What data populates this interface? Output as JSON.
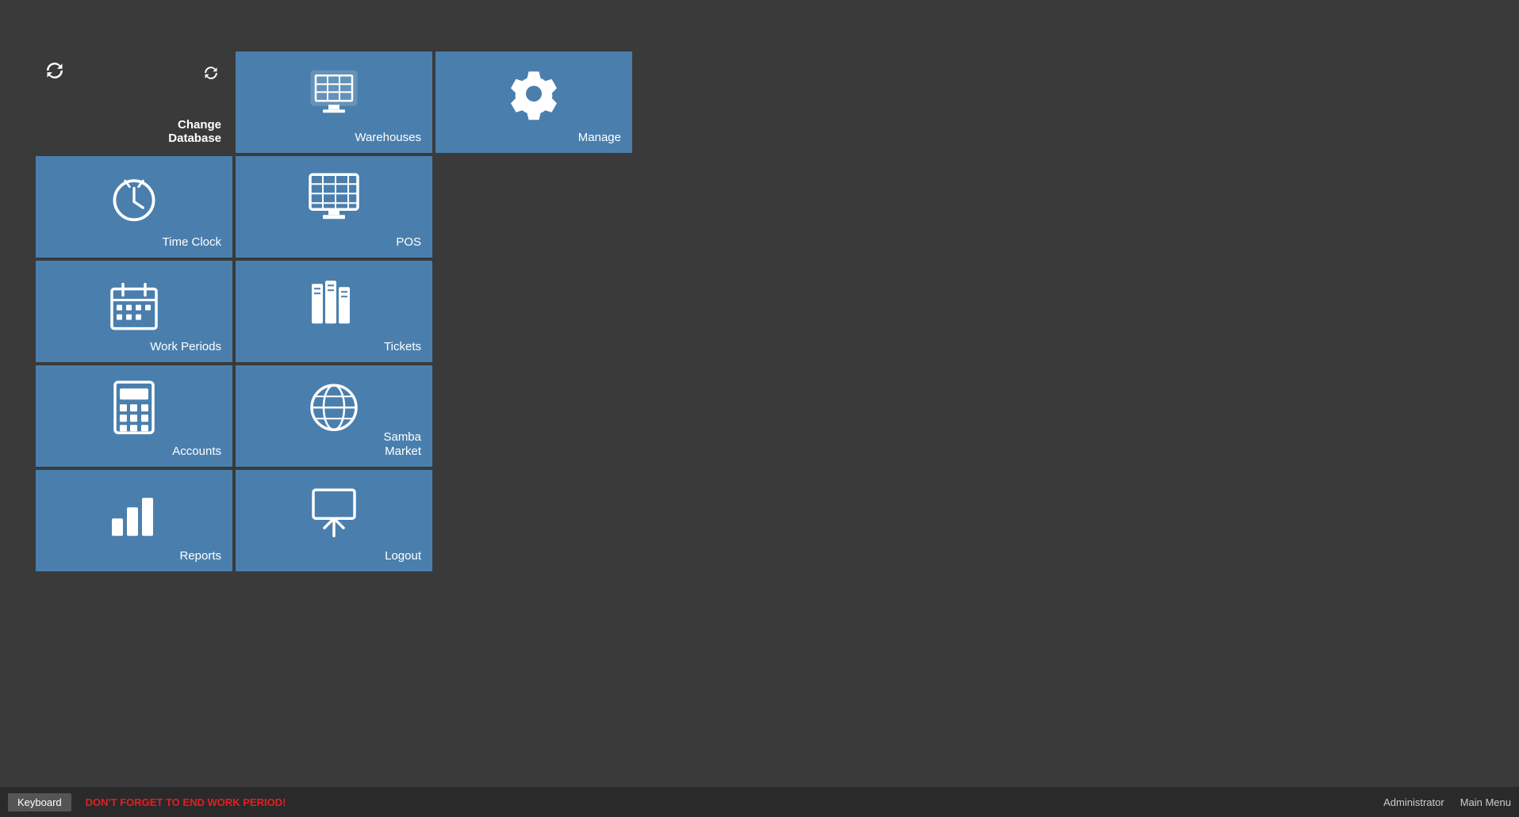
{
  "tiles": [
    {
      "id": "change-database",
      "label": "Change\nDatabase",
      "label_lines": [
        "Change",
        "Database"
      ],
      "bold": true,
      "dark": true,
      "icon": "sync",
      "col": 1,
      "row": 1
    },
    {
      "id": "warehouses",
      "label": "Warehouses",
      "bold": false,
      "dark": false,
      "icon": "warehouses",
      "col": 2,
      "row": 1
    },
    {
      "id": "manage",
      "label": "Manage",
      "bold": false,
      "dark": false,
      "icon": "gear",
      "col": 3,
      "row": 1
    },
    {
      "id": "time-clock",
      "label": "Time Clock",
      "bold": false,
      "dark": false,
      "icon": "clock",
      "col": 1,
      "row": 2
    },
    {
      "id": "pos",
      "label": "POS",
      "bold": false,
      "dark": false,
      "icon": "monitor",
      "col": 2,
      "row": 2
    },
    {
      "id": "work-periods",
      "label": "Work Periods",
      "bold": false,
      "dark": false,
      "icon": "calendar",
      "col": 1,
      "row": 3
    },
    {
      "id": "tickets",
      "label": "Tickets",
      "bold": false,
      "dark": false,
      "icon": "books",
      "col": 2,
      "row": 3
    },
    {
      "id": "accounts",
      "label": "Accounts",
      "bold": false,
      "dark": false,
      "icon": "calculator",
      "col": 1,
      "row": 4
    },
    {
      "id": "samba-market",
      "label": "Samba\nMarket",
      "label_lines": [
        "Samba",
        "Market"
      ],
      "bold": false,
      "dark": false,
      "icon": "globe",
      "col": 2,
      "row": 4
    },
    {
      "id": "reports",
      "label": "Reports",
      "bold": false,
      "dark": false,
      "icon": "bar-chart",
      "col": 1,
      "row": 5
    },
    {
      "id": "logout",
      "label": "Logout",
      "bold": false,
      "dark": false,
      "icon": "logout",
      "col": 2,
      "row": 5
    }
  ],
  "bottom_bar": {
    "keyboard_label": "Keyboard",
    "warning_text": "DON'T FORGET TO END WORK PERIOD!",
    "user_label": "Administrator",
    "menu_label": "Main Menu"
  }
}
